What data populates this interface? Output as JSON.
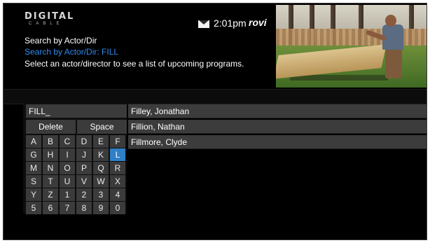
{
  "header": {
    "logo_top": "DIGITAL",
    "logo_bottom": "CABLE",
    "mail_icon": "envelope-icon",
    "time": "2:01pm",
    "brand": "rovi"
  },
  "search": {
    "breadcrumb": "Search by Actor/Dir",
    "query_line": "Search by Actor/Dir: FILL",
    "instructions": "Select an actor/director to see a list of upcoming programs."
  },
  "keyboard": {
    "entry_text": "FILL_",
    "delete_label": "Delete",
    "space_label": "Space",
    "selected_key": "L",
    "keys": [
      "A",
      "B",
      "C",
      "D",
      "E",
      "F",
      "G",
      "H",
      "I",
      "J",
      "K",
      "L",
      "M",
      "N",
      "O",
      "P",
      "Q",
      "R",
      "S",
      "T",
      "U",
      "V",
      "W",
      "X",
      "Y",
      "Z",
      "1",
      "2",
      "3",
      "4",
      "5",
      "6",
      "7",
      "8",
      "9",
      "0"
    ]
  },
  "results": [
    "Filley, Jonathan",
    "Fillion, Nathan",
    "Fillmore, Clyde"
  ],
  "colors": {
    "accent": "#2f7fc8",
    "query_text": "#2d8cf0",
    "key_bg": "#3b3b3b",
    "screen_bg": "#000000"
  }
}
